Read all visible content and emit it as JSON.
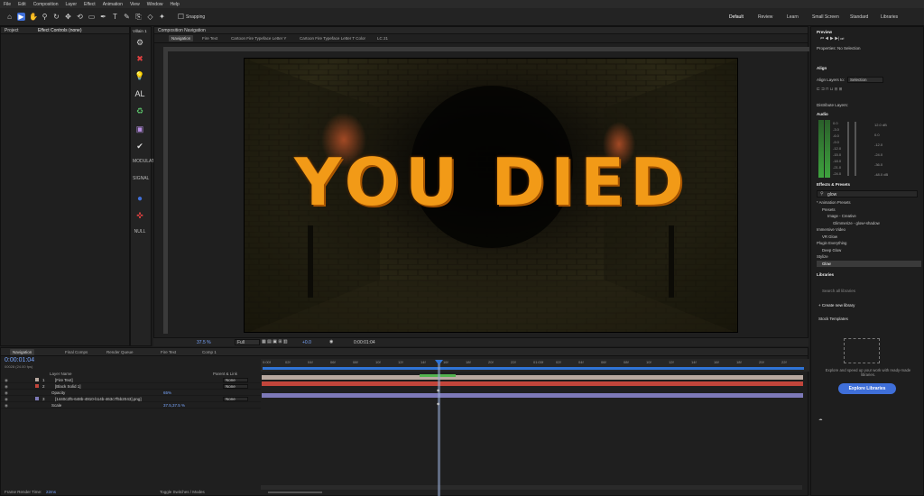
{
  "menu": [
    "File",
    "Edit",
    "Composition",
    "Layer",
    "Effect",
    "Animation",
    "View",
    "Window",
    "Help"
  ],
  "toolbar": {
    "snapping": "Snapping"
  },
  "workspaces": [
    "Default",
    "Review",
    "Learn",
    "Small Screen",
    "Standard",
    "Libraries"
  ],
  "left": {
    "tabs": [
      "Project",
      "Effect Controls (none)"
    ]
  },
  "vertical": {
    "title": "Villain 1",
    "items": [
      "AL",
      "MODULATI",
      "SIGNAL",
      "NULL"
    ]
  },
  "comp": {
    "header": "Composition Navigation",
    "tabs": [
      "Navigation",
      "Fire Text",
      "Cartoon Fire Typeface Letter Y",
      "Cartoon Fire Typeface Letter T Color",
      "LC 21"
    ],
    "text": "YOU DIED",
    "bottom": {
      "zoom": "37.5 %",
      "res": "Full",
      "exposure": "+0.0",
      "time": "0:00:01:04"
    }
  },
  "timeline": {
    "tabs": [
      "Navigation",
      "Final Comps",
      "Render Queue",
      "Fire Text",
      "Comp 1"
    ],
    "timecode": "0:00:01:04",
    "fps": "00028 (24.00 fps)",
    "cols": {
      "name": "Layer Name",
      "parent": "Parent & Link"
    },
    "layers": [
      {
        "num": "1",
        "name": "[Fire Text]",
        "parent": "None"
      },
      {
        "num": "2",
        "name": "[Black Solid 1]",
        "parent": "None"
      },
      {
        "num": "",
        "name": "Opacity",
        "value": "65%"
      },
      {
        "num": "3",
        "name": "[1440c2f5-648b-4910-b14b-463c7f5b2043].png]",
        "parent": "None"
      },
      {
        "num": "",
        "name": "Scale",
        "value": "37.5,37.5 %"
      }
    ],
    "ruler": [
      "0:00f",
      "02f",
      "04f",
      "06f",
      "08f",
      "10f",
      "12f",
      "14f",
      "16f",
      "18f",
      "20f",
      "22f",
      "01:00f",
      "02f",
      "04f",
      "06f",
      "08f",
      "10f",
      "12f",
      "14f",
      "16f",
      "18f",
      "20f",
      "22f"
    ],
    "footer": {
      "render_label": "Frame Render Time:",
      "render_value": "22ms",
      "toggle": "Toggle Switches / Modes"
    }
  },
  "right": {
    "preview": "Preview",
    "properties": "Properties: No Selection",
    "align": "Align",
    "align_to": "Align Layers to:",
    "align_val": "Selection",
    "distribute": "Distribute Layers:",
    "audio": "Audio",
    "audio_left": [
      "0.0",
      "-3.0",
      "-6.0",
      "-9.0",
      "-12.0",
      "-15.0",
      "-18.0",
      "-21.0",
      "-24.0"
    ],
    "audio_right": [
      "12.0 dB",
      "0.0",
      "-12.0",
      "-24.0",
      "-36.0",
      "-48.0 dB"
    ],
    "effects": "Effects & Presets",
    "search": "glow",
    "tree": [
      "* Animation Presets",
      "Presets",
      "Image - Creative",
      "Glimmerize - glow+shadow",
      "Immersive Video",
      "VR Glow",
      "Plugin Everything",
      "Deep Glow",
      "Stylize",
      "Glow"
    ],
    "libraries": "Libraries",
    "lib_search": "Search all libraries",
    "create": "Create new library",
    "stock": "Stock Templates",
    "desc": "Explore and speed up your work with ready-made libraries.",
    "explore": "Explore Libraries"
  },
  "colors": {
    "accent": "#3f6fd9",
    "text_fill": "#f29a17",
    "ruler_blue": "#2f74d6"
  }
}
